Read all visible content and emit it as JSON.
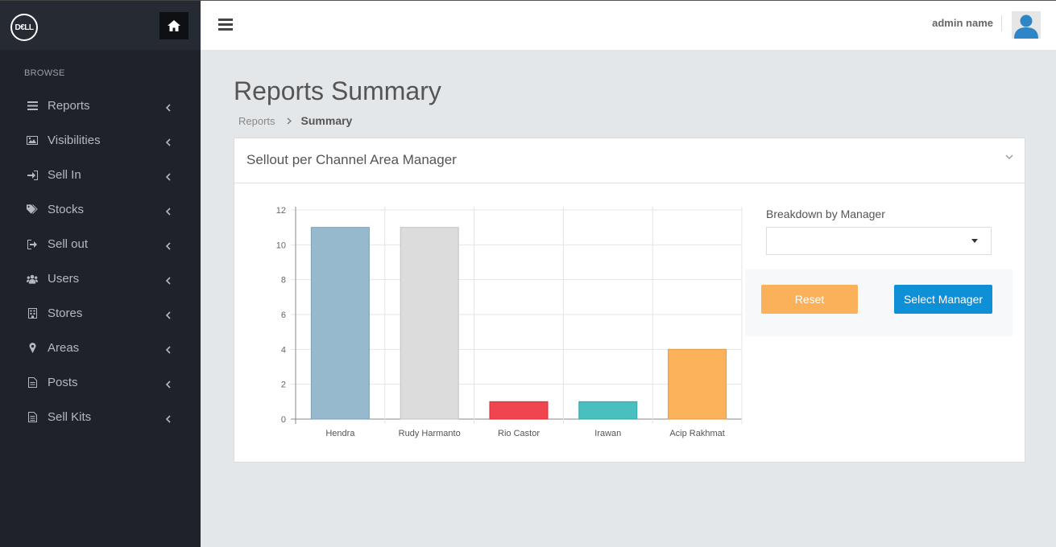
{
  "sidebar": {
    "logo_text": "D€LL",
    "browse_label": "BROWSE",
    "items": [
      {
        "label": "Reports",
        "icon": "list-icon"
      },
      {
        "label": "Visibilities",
        "icon": "image-icon"
      },
      {
        "label": "Sell In",
        "icon": "sign-in-icon"
      },
      {
        "label": "Stocks",
        "icon": "tags-icon"
      },
      {
        "label": "Sell out",
        "icon": "sign-out-icon"
      },
      {
        "label": "Users",
        "icon": "users-icon"
      },
      {
        "label": "Stores",
        "icon": "building-icon"
      },
      {
        "label": "Areas",
        "icon": "map-marker-icon"
      },
      {
        "label": "Posts",
        "icon": "file-icon"
      },
      {
        "label": "Sell Kits",
        "icon": "file-text-icon"
      }
    ]
  },
  "header": {
    "user_name": "admin name"
  },
  "page": {
    "title": "Reports Summary",
    "breadcrumb": [
      "Reports",
      "Summary"
    ]
  },
  "panel": {
    "title": "Sellout per Channel Area Manager"
  },
  "form": {
    "breakdown_label": "Breakdown by Manager",
    "select_value": "",
    "reset_label": "Reset",
    "select_label": "Select Manager"
  },
  "colors": {
    "bar_colors": [
      "#97b9ce",
      "#dcdcdc",
      "#f0444f",
      "#4abfbf",
      "#fcb25a"
    ],
    "accent": "#0e8fd6",
    "reset": "#fbb05a"
  },
  "chart_data": {
    "type": "bar",
    "categories": [
      "Hendra",
      "Rudy Harmanto",
      "Rio Castor",
      "Irawan",
      "Acip Rakhmat"
    ],
    "values": [
      11,
      11,
      1,
      1,
      4
    ],
    "ylim": [
      0,
      12
    ],
    "yticks": [
      0,
      2,
      4,
      6,
      8,
      10,
      12
    ],
    "grid": true
  }
}
